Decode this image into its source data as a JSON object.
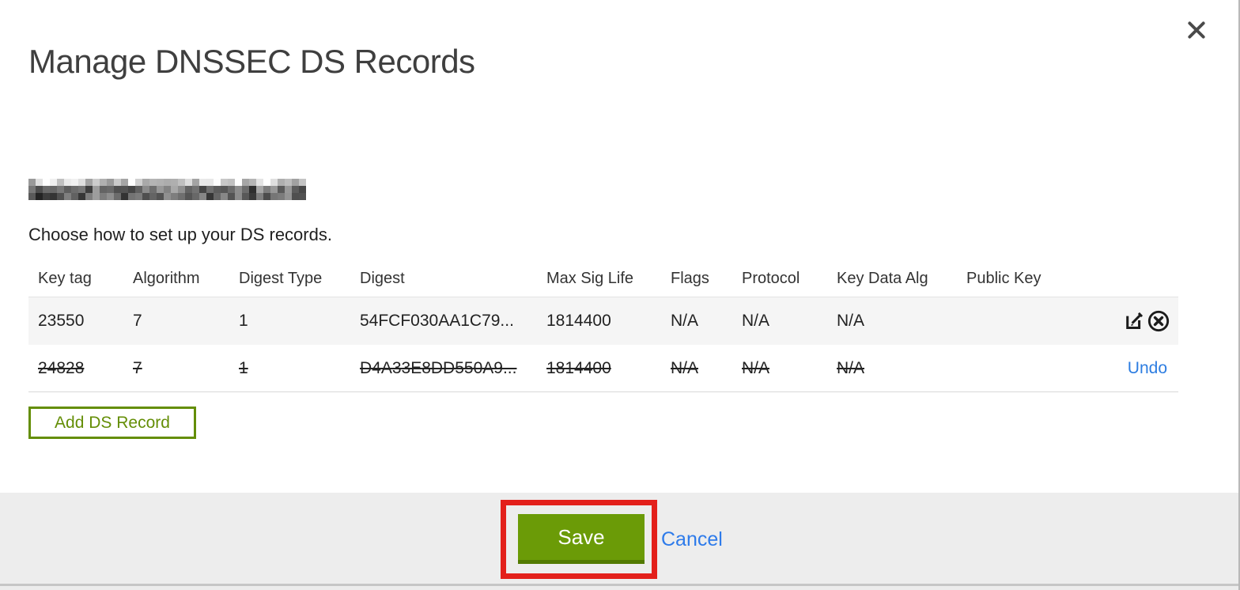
{
  "modal": {
    "title": "Manage DNSSEC DS Records",
    "instruction": "Choose how to set up your DS records.",
    "domain_redacted": true
  },
  "table": {
    "headers": {
      "key_tag": "Key tag",
      "algorithm": "Algorithm",
      "digest_type": "Digest Type",
      "digest": "Digest",
      "max_sig_life": "Max Sig Life",
      "flags": "Flags",
      "protocol": "Protocol",
      "key_data_alg": "Key Data Alg",
      "public_key": "Public Key"
    },
    "rows": [
      {
        "key_tag": "23550",
        "algorithm": "7",
        "digest_type": "1",
        "digest": "54FCF030AA1C79...",
        "max_sig_life": "1814400",
        "flags": "N/A",
        "protocol": "N/A",
        "key_data_alg": "N/A",
        "public_key": "",
        "state": "normal"
      },
      {
        "key_tag": "24828",
        "algorithm": "7",
        "digest_type": "1",
        "digest": "D4A33E8DD550A9...",
        "max_sig_life": "1814400",
        "flags": "N/A",
        "protocol": "N/A",
        "key_data_alg": "N/A",
        "public_key": "",
        "state": "deleted",
        "undo_label": "Undo"
      }
    ]
  },
  "buttons": {
    "add_ds_record": "Add DS Record",
    "save": "Save",
    "cancel": "Cancel"
  },
  "colors": {
    "green": "#6b9b07",
    "green_dark": "#527a00",
    "outline_green": "#648e06",
    "link_blue": "#2d7de1",
    "annotation_red": "#e3201b",
    "row_gray": "#f5f5f5",
    "footer_gray": "#ededed"
  }
}
